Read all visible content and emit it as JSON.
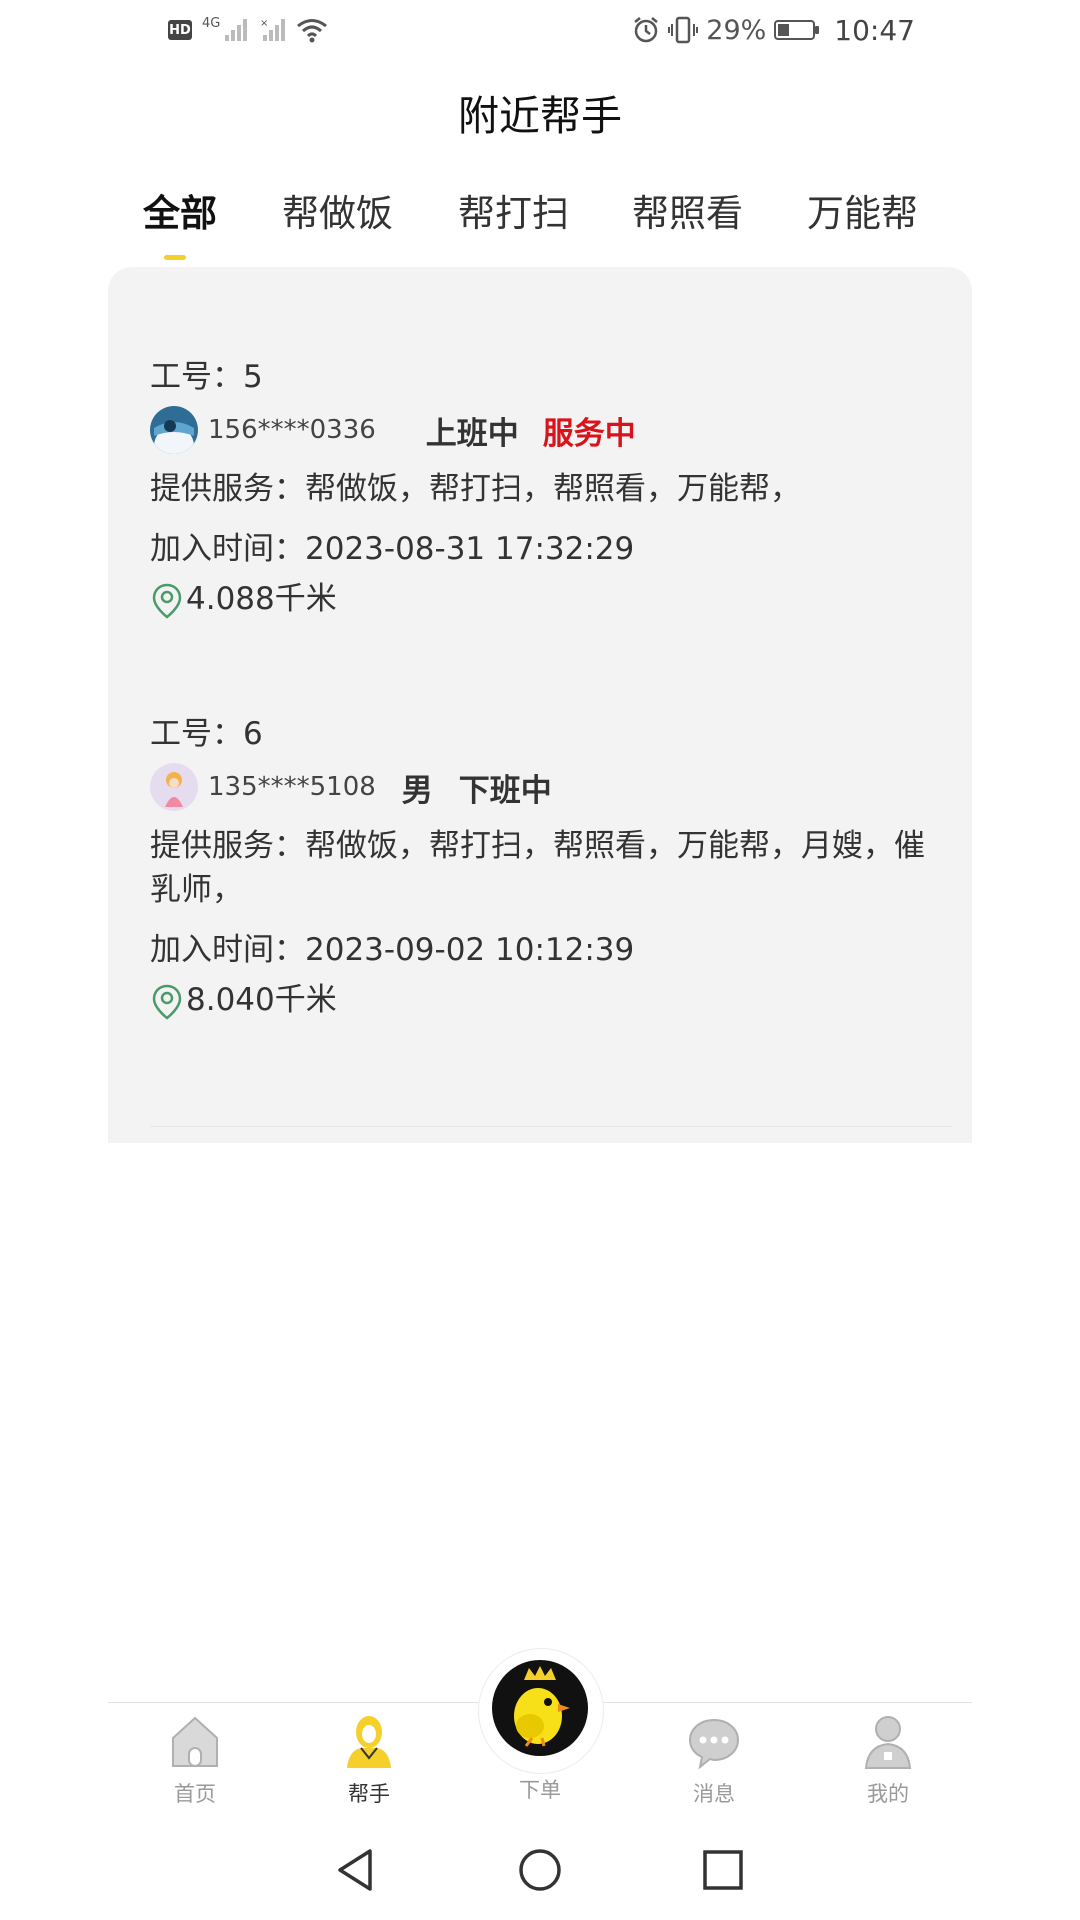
{
  "status_bar": {
    "hd": "HD",
    "network": "4G",
    "battery_percent": "29%",
    "time": "10:47",
    "icons": [
      "hd-icon",
      "signal-icon",
      "signal-icon",
      "wifi-icon",
      "alarm-icon",
      "vibrate-icon",
      "battery-icon"
    ]
  },
  "header": {
    "title": "附近帮手"
  },
  "tabs": [
    {
      "label": "全部",
      "active": true
    },
    {
      "label": "帮做饭",
      "active": false
    },
    {
      "label": "帮打扫",
      "active": false
    },
    {
      "label": "帮照看",
      "active": false
    },
    {
      "label": "万能帮",
      "active": false
    }
  ],
  "helpers": [
    {
      "work_id": "工号：5",
      "phone": "156****0336",
      "gender": "",
      "status": "上班中",
      "service_status": "服务中",
      "services": "提供服务：帮做饭，帮打扫，帮照看，万能帮，",
      "join_time": "加入时间：2023-08-31 17:32:29",
      "distance": "4.088千米"
    },
    {
      "work_id": "工号：6",
      "phone": "135****5108",
      "gender": "男",
      "status": "下班中",
      "service_status": "",
      "services": "提供服务：帮做饭，帮打扫，帮照看，万能帮，月嫂，催乳师，",
      "join_time": "加入时间：2023-09-02 10:12:39",
      "distance": "8.040千米"
    }
  ],
  "bottom_nav": [
    {
      "label": "首页",
      "icon": "home-icon",
      "active": false
    },
    {
      "label": "帮手",
      "icon": "helper-icon",
      "active": true
    },
    {
      "label": "下单",
      "icon": "order-icon",
      "active": false
    },
    {
      "label": "消息",
      "icon": "message-icon",
      "active": false
    },
    {
      "label": "我的",
      "icon": "profile-icon",
      "active": false
    }
  ],
  "colors": {
    "accent": "#f5cf2a",
    "status_red": "#d9131b",
    "panel_bg": "#f3f3f3",
    "pin_green": "#4a9a6a"
  }
}
